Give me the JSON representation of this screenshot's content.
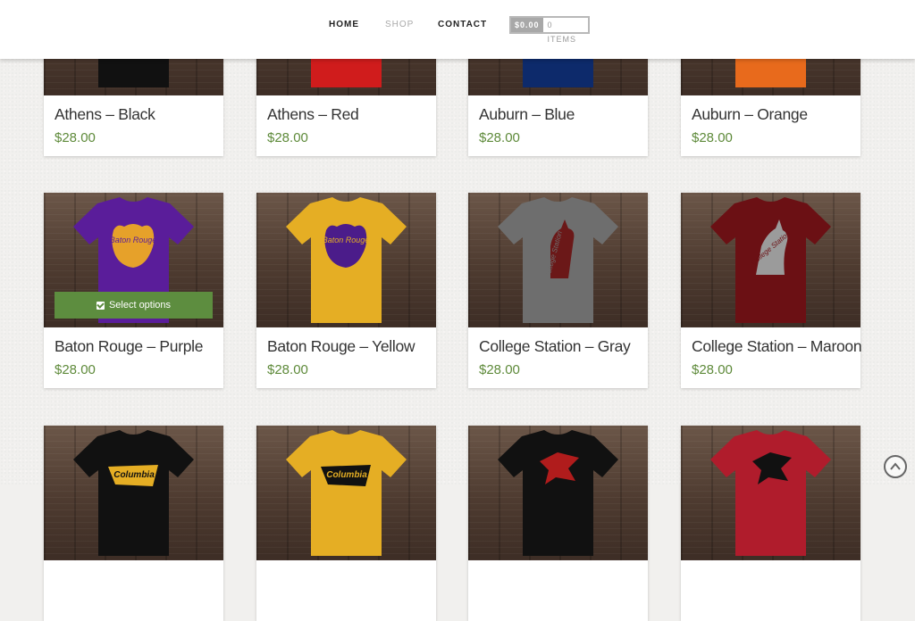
{
  "nav": {
    "home": "HOME",
    "shop": "SHOP",
    "contact": "CONTACT",
    "cart_total": "$0.00",
    "cart_items": "0 ITEMS"
  },
  "products": [
    {
      "title": "Athens – Black",
      "price": "$28.00",
      "shirt_color": "#111111"
    },
    {
      "title": "Athens – Red",
      "price": "$28.00",
      "shirt_color": "#d01c1c"
    },
    {
      "title": "Auburn – Blue",
      "price": "$28.00",
      "shirt_color": "#0d2a6b"
    },
    {
      "title": "Auburn – Orange",
      "price": "$28.00",
      "shirt_color": "#e86a1c"
    },
    {
      "title": "Baton Rouge – Purple",
      "price": "$28.00",
      "shirt_color": "#5a1d9a",
      "graphic_color": "#e6a12a",
      "graphic_text": "Baton Rouge"
    },
    {
      "title": "Baton Rouge – Yellow",
      "price": "$28.00",
      "shirt_color": "#e5ae24",
      "graphic_color": "#4b1c8a",
      "graphic_text": "Baton Rouge"
    },
    {
      "title": "College Station – Gray",
      "price": "$28.00",
      "shirt_color": "#6e6e6e",
      "graphic_color": "#6b1818",
      "graphic_text": "College Station"
    },
    {
      "title": "College Station – Maroon",
      "price": "$28.00",
      "shirt_color": "#6b1014",
      "graphic_color": "#9b9b9b",
      "graphic_text": "College Station"
    },
    {
      "title": "",
      "price": "",
      "shirt_color": "#111111",
      "graphic_color": "#e5ae24",
      "graphic_text": "Columbia"
    },
    {
      "title": "",
      "price": "",
      "shirt_color": "#e5ae24",
      "graphic_color": "#111111",
      "graphic_text": "Columbia"
    },
    {
      "title": "",
      "price": "",
      "shirt_color": "#111111",
      "graphic_color": "#b01c1c",
      "graphic_text": ""
    },
    {
      "title": "",
      "price": "",
      "shirt_color": "#b01c2c",
      "graphic_color": "#111111",
      "graphic_text": ""
    }
  ],
  "select_options_label": "Select options"
}
